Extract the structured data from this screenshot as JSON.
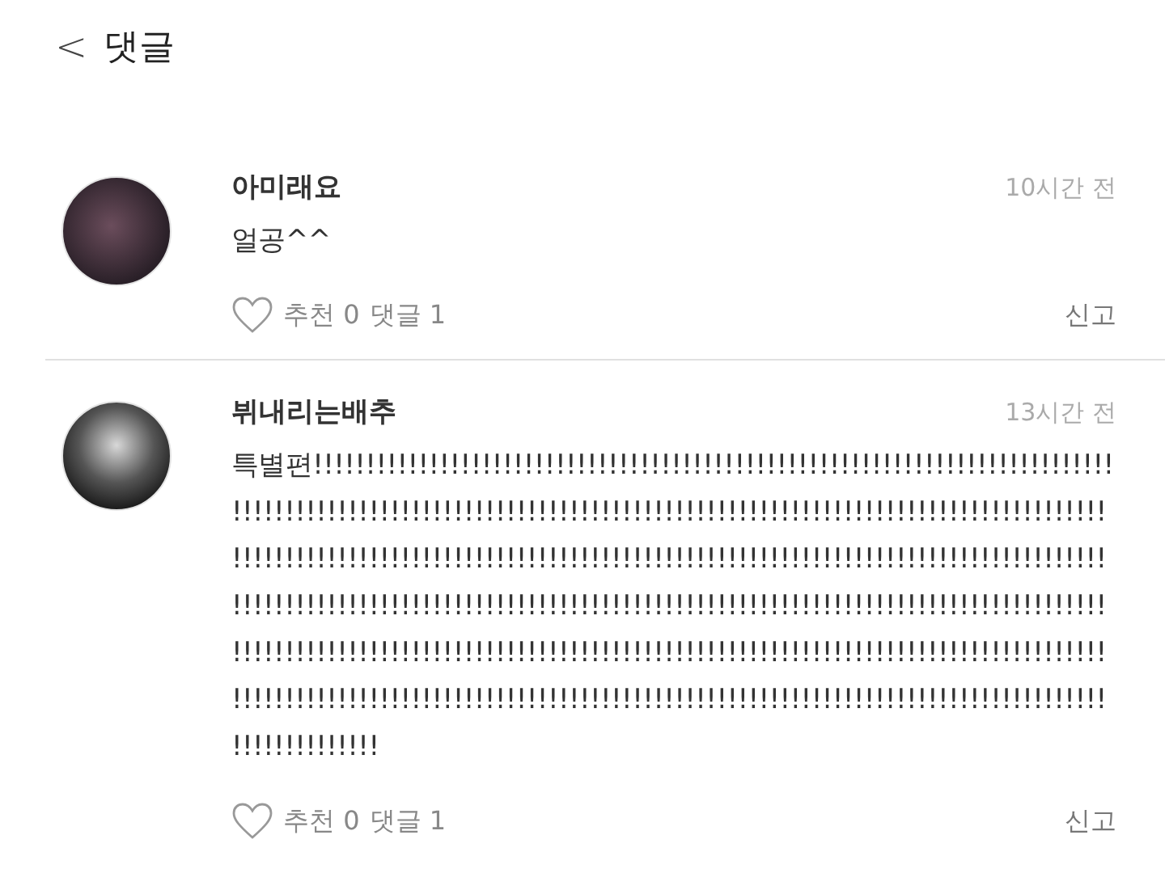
{
  "header": {
    "back_icon": "<",
    "title": "댓글"
  },
  "comments": [
    {
      "author": "아미래요",
      "time": "10시간 전",
      "text": "얼공^^",
      "likes": "추천 0",
      "replies": "댓글 1",
      "report": "신고"
    },
    {
      "author": "뷔내리는배추",
      "time": "13시간 전",
      "text": "특별편!!!!!!!!!!!!!!!!!!!!!!!!!!!!!!!!!!!!!!!!!!!!!!!!!!!!!!!!!!!!!!!!!!!!!!!!!!!!!!!!!!!!!!!!!!!!!!!!!!!!!!!!!!!!!!!!!!!!!!!!!!!!!!!!!!!!!!!!!!!!!!!!!!!!!!!!!!!!!!!!!!!!!!!!!!!!!!!!!!!!!!!!!!!!!!!!!!!!!!!!!!!!!!!!!!!!!!!!!!!!!!!!!!!!!!!!!!!!!!!!!!!!!!!!!!!!!!!!!!!!!!!!!!!!!!!!!!!!!!!!!!!!!!!!!!!!!!!!!!!!!!!!!!!!!!!!!!!!!!!!!!!!!!!!!!!!!!!!!!!!!!!!!!!!!!!!!!!!!!!!!!!!!!!!!!!!!!!!!!!!!!!!!!!!!!!!!!!!!!!!!!!!!!!!!!!!!!!!!!!!!!!!!!!!!!!!!!!!!!!!!!!!!!!!!!!!!!!!!!!!!!!!!!!!!!!!!!!!!!!!!!!!!!!!!!!!!!!!!!!!!!!!!",
      "likes": "추천 0",
      "replies": "댓글 1",
      "report": "신고"
    }
  ]
}
